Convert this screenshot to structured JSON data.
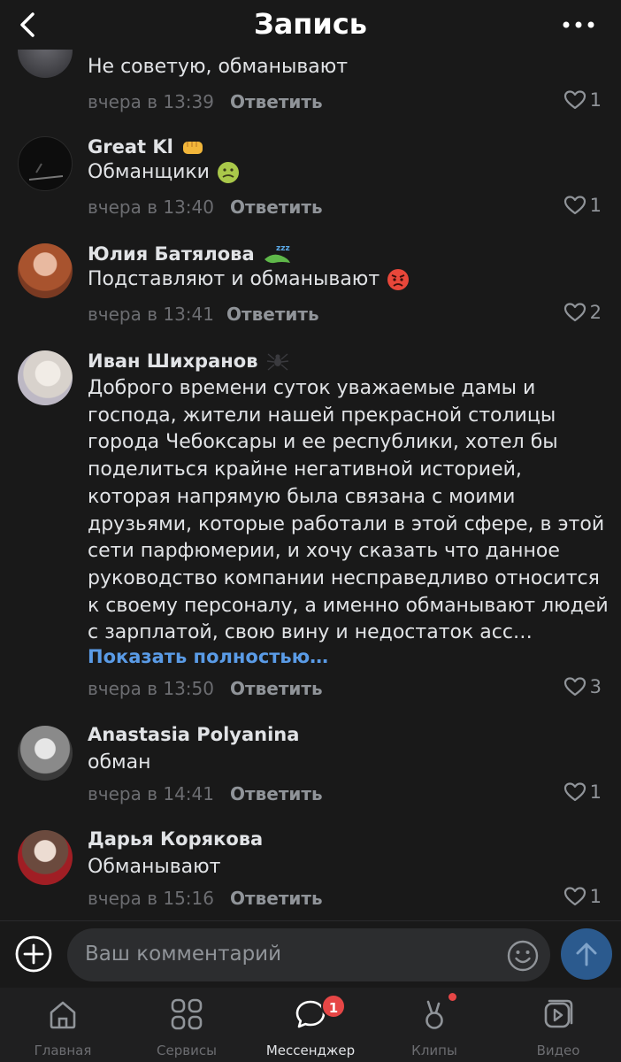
{
  "header": {
    "title": "Запись",
    "back_icon": "chevron-left-icon",
    "more_icon": "more-horizontal-icon"
  },
  "comments": [
    {
      "name": "",
      "text": "Не советую, обманывают",
      "time": "вчера в 13:39",
      "reply": "Ответить",
      "likes": "1"
    },
    {
      "name": "Great Kl",
      "name_emoji": "fist-emoji",
      "text": "Обманщики",
      "text_emoji": "nauseated-emoji",
      "time": "вчера в 13:40",
      "reply": "Ответить",
      "likes": "1"
    },
    {
      "name": "Юлия Батялова",
      "name_emoji": "sleeping-lizard-emoji",
      "text": "Подставляют и обманывают",
      "text_emoji": "angry-emoji",
      "time": "вчера в 13:41",
      "reply": "Ответить",
      "likes": "2"
    },
    {
      "name": "Иван Шихранов",
      "name_emoji": "spider-emoji",
      "text": "Доброго времени суток уважаемые дамы и господа, жители нашей прекрасной столицы города Чебоксары и ее  республики, хотел бы поделиться крайне негативной историей, которая напрямую была связана с моими друзьями, которые работали в этой сфере, в этой сети парфюмерии, и хочу сказать что данное руководство компании несправедливо относится к своему персоналу, а именно обманывают людей с зарплатой, свою вину и недостаток асс…",
      "show_more": "Показать полностью…",
      "time": "вчера в 13:50",
      "reply": "Ответить",
      "likes": "3"
    },
    {
      "name": "Anastasia Polyanina",
      "text": "обман",
      "time": "вчера в 14:41",
      "reply": "Ответить",
      "likes": "1"
    },
    {
      "name": "Дарья Корякова",
      "text": "Обманывают",
      "time": "вчера в 15:16",
      "reply": "Ответить",
      "likes": "1"
    }
  ],
  "input": {
    "placeholder": "Ваш комментарий",
    "add_icon": "plus-circle-icon",
    "emoji_icon": "smile-icon",
    "send_icon": "arrow-up-icon"
  },
  "tabs": [
    {
      "label": "Главная",
      "icon": "home-icon"
    },
    {
      "label": "Сервисы",
      "icon": "services-grid-icon"
    },
    {
      "label": "Мессенджер",
      "icon": "message-icon",
      "badge": "1",
      "active": true
    },
    {
      "label": "Клипы",
      "icon": "clips-icon",
      "dot": true
    },
    {
      "label": "Видео",
      "icon": "video-icon"
    }
  ],
  "colors": {
    "background": "#191919",
    "accent": "#5a9be6",
    "badge": "#e64646",
    "send": "#2b5a8e"
  }
}
